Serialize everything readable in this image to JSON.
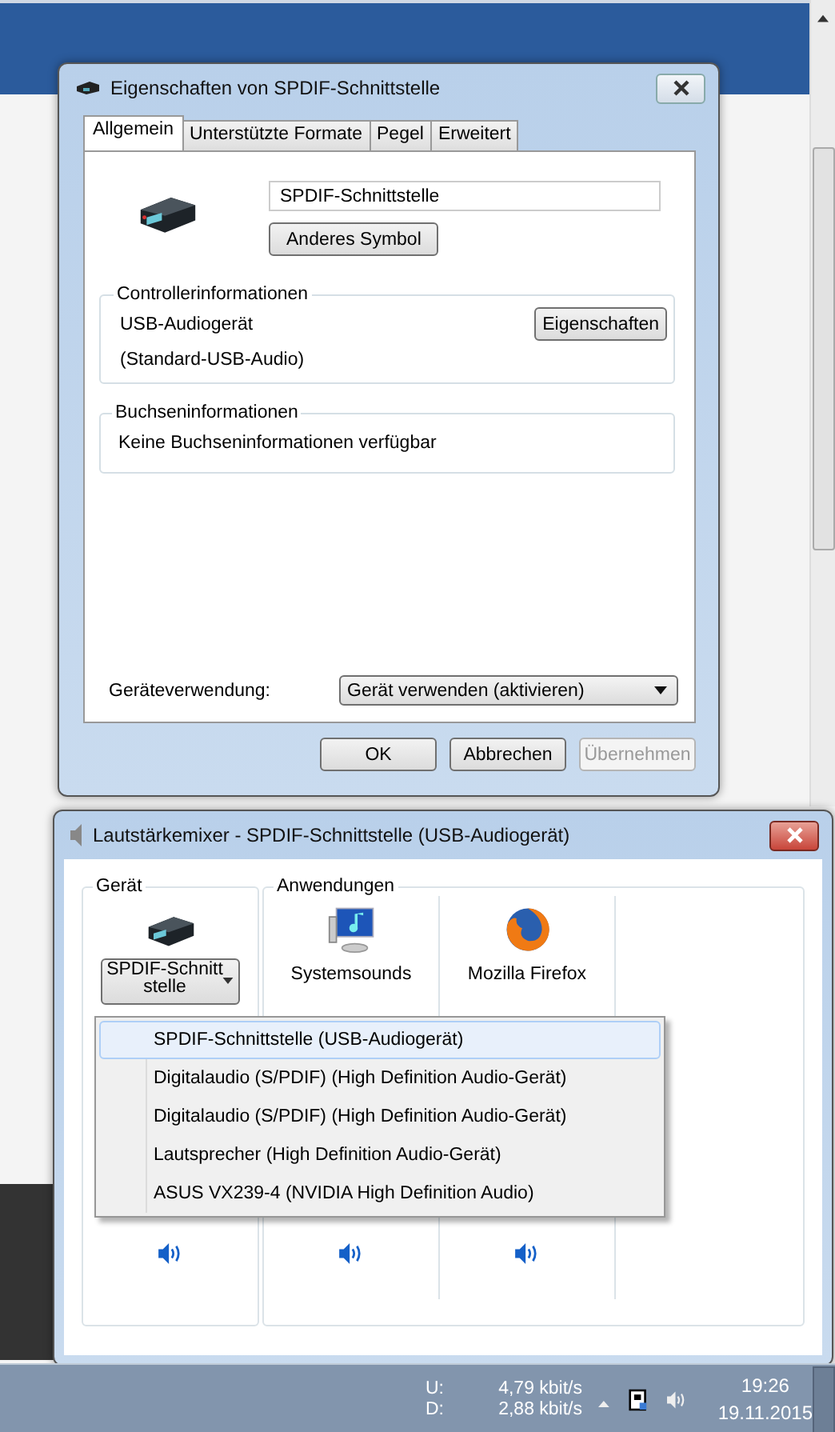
{
  "properties_window": {
    "title": "Eigenschaften von SPDIF-Schnittstelle",
    "tabs": [
      {
        "label": "Allgemein",
        "selected": true
      },
      {
        "label": "Unterstützte Formate",
        "selected": false
      },
      {
        "label": "Pegel",
        "selected": false
      },
      {
        "label": "Erweitert",
        "selected": false
      }
    ],
    "device_name": "SPDIF-Schnittstelle",
    "change_icon_button": "Anderes Symbol",
    "controller_group": {
      "title": "Controllerinformationen",
      "name": "USB-Audiogerät",
      "driver": "(Standard-USB-Audio)",
      "button": "Eigenschaften"
    },
    "jack_group": {
      "title": "Buchseninformationen",
      "text": "Keine Buchseninformationen verfügbar"
    },
    "usage": {
      "label": "Geräteverwendung:",
      "value": "Gerät verwenden (aktivieren)"
    },
    "buttons": [
      {
        "label": "OK",
        "disabled": false
      },
      {
        "label": "Abbrechen",
        "disabled": false
      },
      {
        "label": "Übernehmen",
        "disabled": true
      }
    ]
  },
  "mixer_window": {
    "title": "Lautstärkemixer - SPDIF-Schnittstelle (USB-Audiogerät)",
    "device_group": {
      "title": "Gerät",
      "device_button_lines": [
        "SPDIF-Schnitt",
        "stelle"
      ]
    },
    "applications_group": {
      "title": "Anwendungen",
      "apps": [
        {
          "name": "Systemsounds",
          "kind": "system"
        },
        {
          "name": "Mozilla Firefox",
          "kind": "browser"
        }
      ]
    },
    "device_menu": [
      {
        "label": "SPDIF-Schnittstelle (USB-Audiogerät)",
        "selected": true
      },
      {
        "label": "Digitalaudio (S/PDIF) (High Definition Audio-Gerät)",
        "selected": false
      },
      {
        "label": "Digitalaudio (S/PDIF) (High Definition Audio-Gerät)",
        "selected": false
      },
      {
        "label": "Lautsprecher (High Definition Audio-Gerät)",
        "selected": false
      },
      {
        "label": "ASUS VX239-4 (NVIDIA High Definition Audio)",
        "selected": false
      }
    ]
  },
  "taskbar": {
    "network": [
      {
        "label": "U:",
        "value": "4,79 kbit/s"
      },
      {
        "label": "D:",
        "value": "2,88 kbit/s"
      }
    ],
    "time": "19:26",
    "date": "19.11.2015"
  }
}
